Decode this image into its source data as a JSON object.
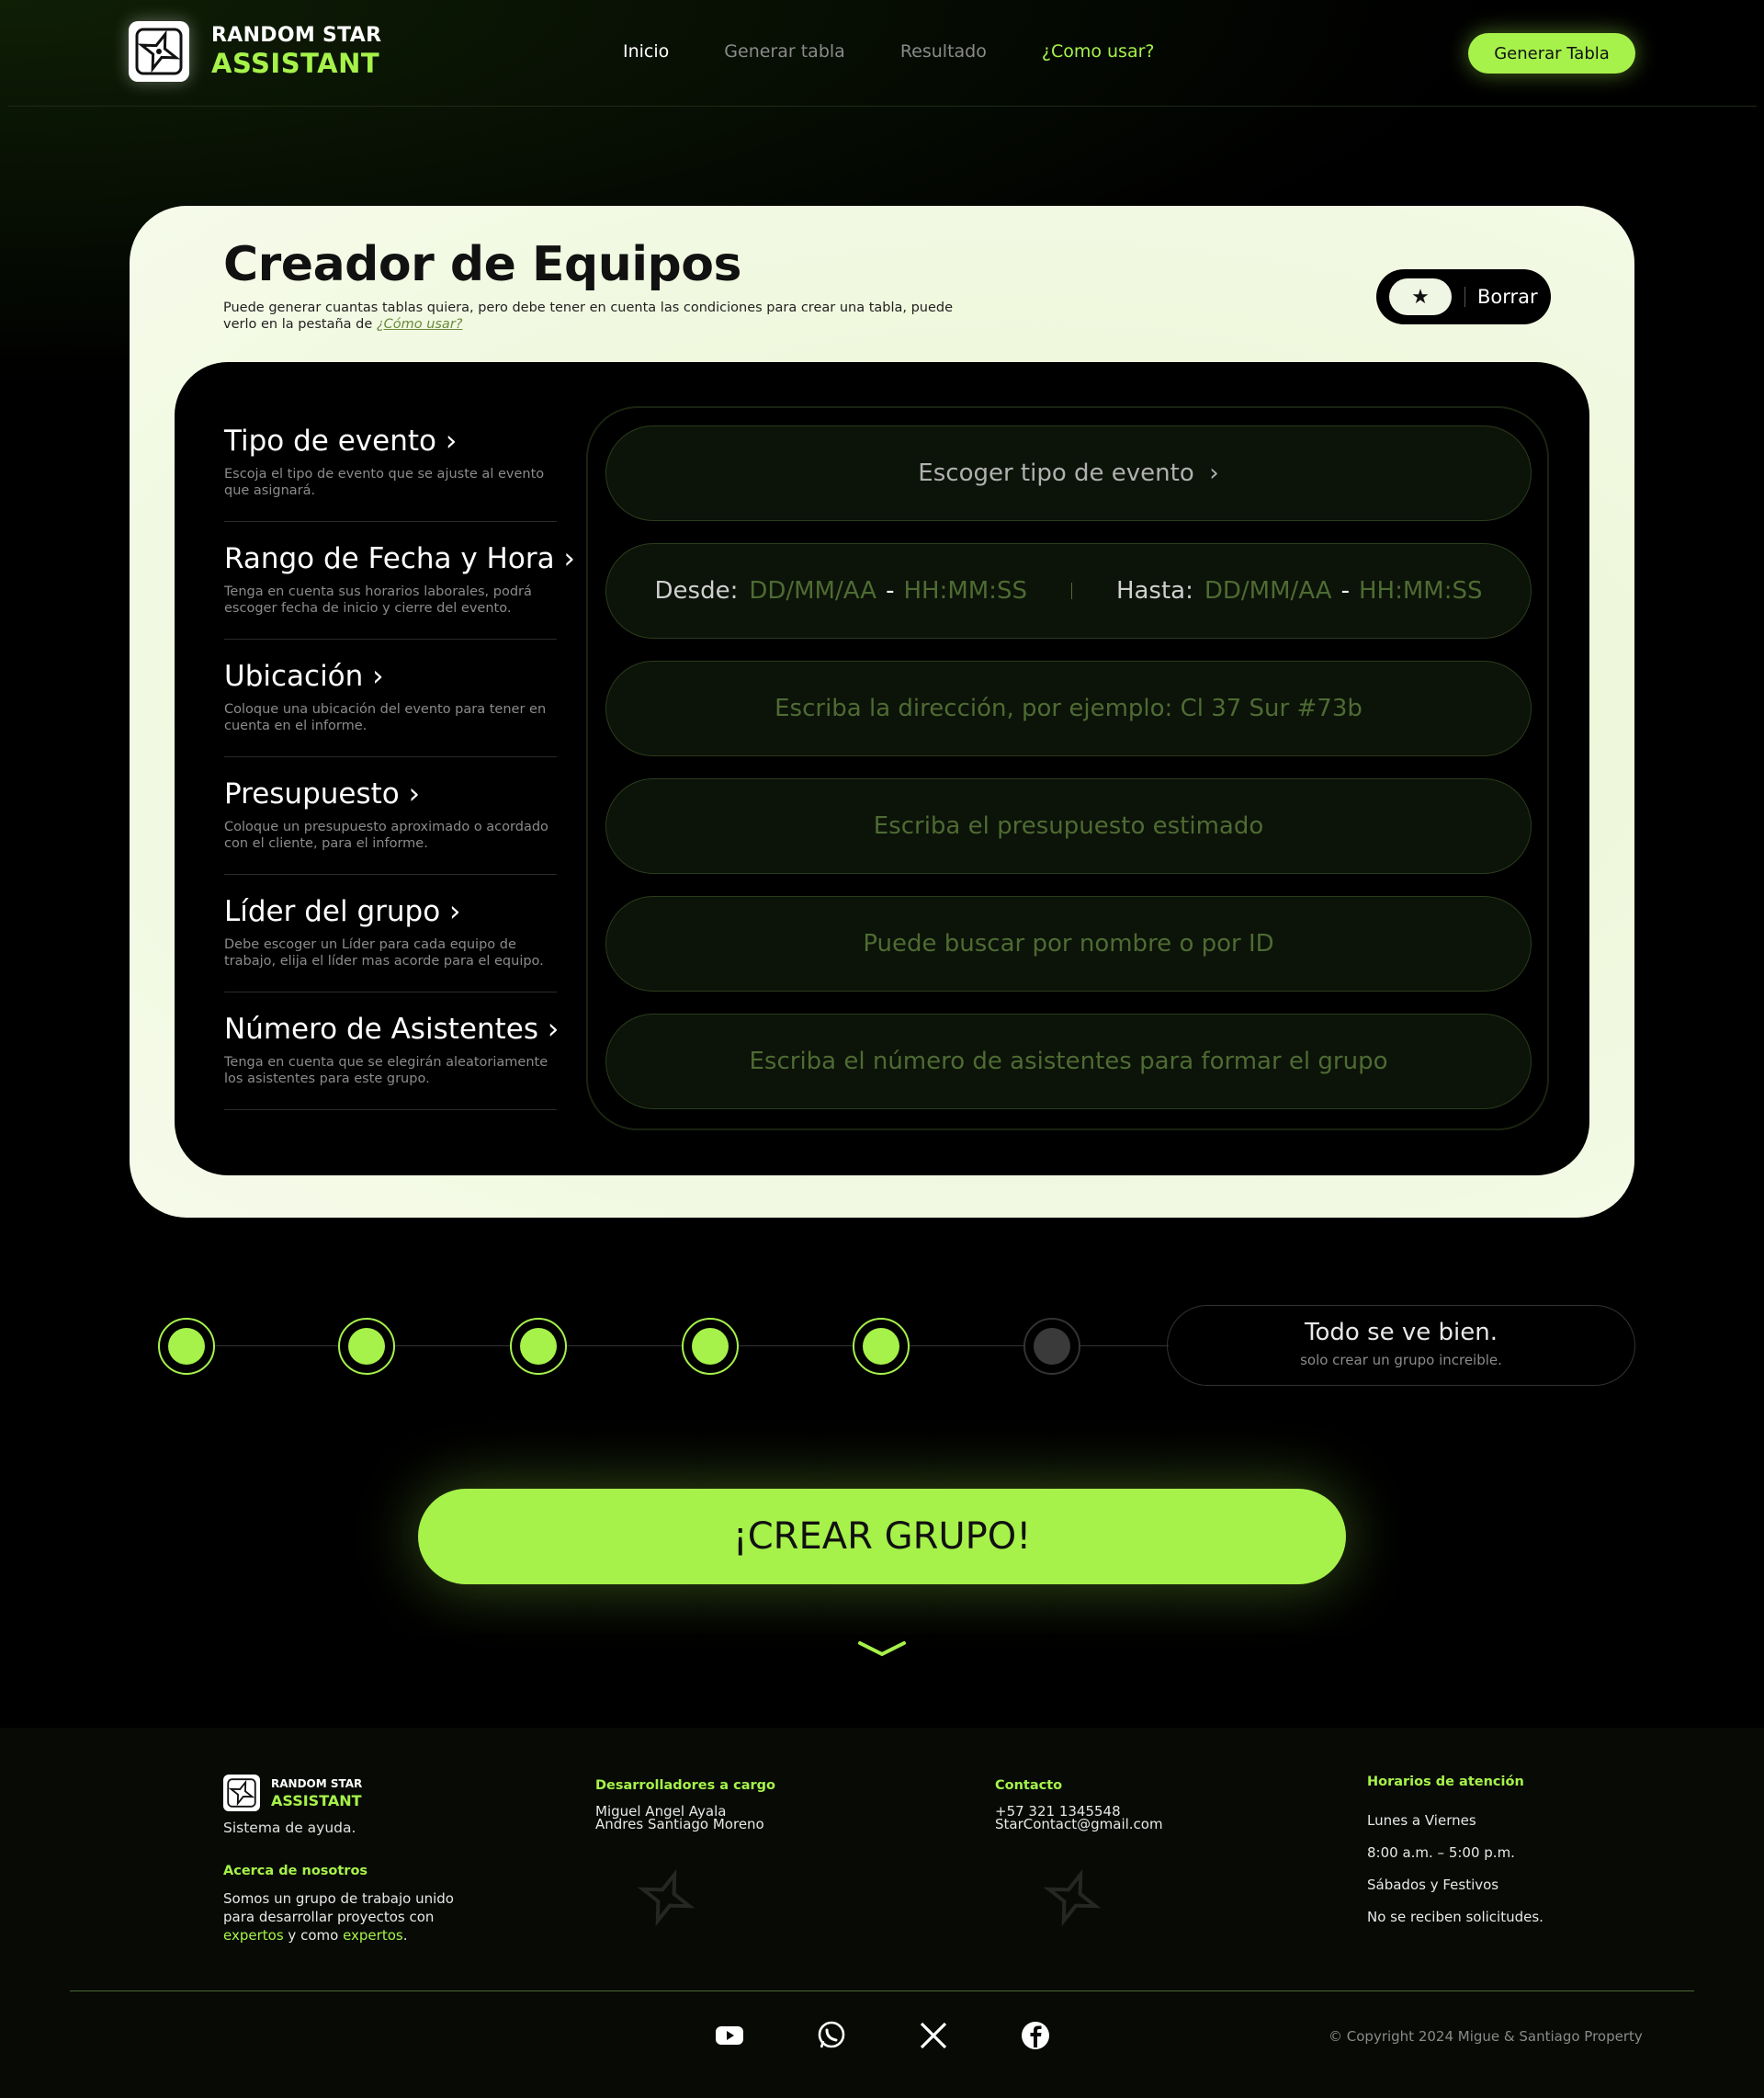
{
  "brand": {
    "line1": "RANDOM STAR",
    "line2": "ASSISTANT"
  },
  "nav": {
    "items": [
      {
        "label": "Inicio"
      },
      {
        "label": "Generar tabla"
      },
      {
        "label": "Resultado"
      },
      {
        "label": "¿Como usar?"
      }
    ],
    "cta_label": "Generar Tabla"
  },
  "card": {
    "title": "Creador de Equipos",
    "subtitle": "Puede generar cuantas tablas quiera, pero debe tener en cuenta las condiciones para crear una tabla, puede verlo en la pestaña de",
    "subtitle_link": "¿Cómo usar?",
    "reset_label": "Borrar"
  },
  "form": {
    "sections": [
      {
        "title": "Tipo de evento",
        "desc": "Escoja el tipo de evento que se ajuste al evento que asignará."
      },
      {
        "title": "Rango de Fecha y Hora",
        "desc": "Tenga en cuenta sus horarios laborales, podrá escoger fecha de inicio y cierre del evento."
      },
      {
        "title": "Ubicación",
        "desc": "Coloque una ubicación del evento para tener en cuenta en el informe."
      },
      {
        "title": "Presupuesto",
        "desc": "Coloque un presupuesto aproximado o acordado con el cliente, para el informe."
      },
      {
        "title": "Líder del grupo",
        "desc": "Debe escoger un Líder para cada equipo de trabajo, elija el líder mas acorde para el equipo."
      },
      {
        "title": "Número de Asistentes",
        "desc": "Tenga en cuenta que se elegirán aleatoriamente los asistentes para este grupo."
      }
    ],
    "event_type_button": "Escoger tipo de evento",
    "date_from_label": "Desde:",
    "date_to_label": "Hasta:",
    "date_placeholder": "DD/MM/AA",
    "time_placeholder": "HH:MM:SS",
    "location_placeholder": "Escriba la dirección, por ejemplo: Cl 37 Sur #73b",
    "budget_placeholder": "Escriba el presupuesto estimado",
    "leader_placeholder": "Puede buscar por nombre o por ID",
    "attendees_placeholder": "Escriba el número de asistentes para formar el grupo"
  },
  "progress": {
    "completed_steps": 5,
    "total_steps": 6,
    "status_title": "Todo se ve bien.",
    "status_sub": "solo crear un grupo increible."
  },
  "create_button": "¡CREAR GRUPO!",
  "footer": {
    "brand_line1": "RANDOM STAR",
    "brand_line2": "ASSISTANT",
    "tagline": "Sistema de ayuda.",
    "about_heading": "Acerca de nosotros",
    "about_text_1": "Somos un grupo de trabajo unido para desarrollar proyectos con",
    "about_hl_1": "expertos",
    "about_text_2": "y como",
    "about_hl_2": "expertos",
    "about_end": ".",
    "devs_heading": "Desarrolladores a cargo",
    "dev1": "Miguel Angel Ayala",
    "dev2": "Andres Santiago Moreno",
    "contact_heading": "Contacto",
    "phone": "+57 321 1345548",
    "email": "StarContact@gmail.com",
    "hours_heading": "Horarios de atención",
    "hours": [
      "Lunes a Viernes",
      "8:00 a.m. – 5:00 p.m.",
      "Sábados y Festivos",
      "No se reciben solicitudes."
    ],
    "socials": [
      "youtube-icon",
      "whatsapp-icon",
      "x-icon",
      "facebook-icon"
    ],
    "copyright": "© Copyright 2024 Migue & Santiago Property"
  },
  "colors": {
    "accent": "#a6f24a",
    "background": "#000000",
    "card": "#eef7db"
  }
}
